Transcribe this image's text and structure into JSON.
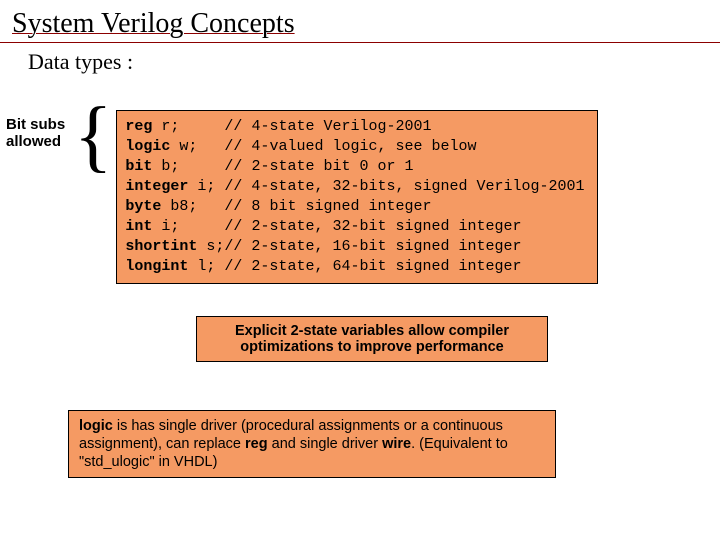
{
  "title": "System Verilog Concepts",
  "subtitle": "Data types :",
  "sideLabel": "Bit subs allowed",
  "code": {
    "lines": [
      {
        "kw": "reg",
        "decl": " r;     ",
        "cmt": "// 4-state Verilog-2001"
      },
      {
        "kw": "logic",
        "decl": " w;   ",
        "cmt": "// 4-valued logic, see below"
      },
      {
        "kw": "bit",
        "decl": " b;     ",
        "cmt": "// 2-state bit 0 or 1"
      },
      {
        "kw": "integer",
        "decl": " i; ",
        "cmt": "// 4-state, 32-bits, signed Verilog-2001"
      },
      {
        "kw": "byte",
        "decl": " b8;   ",
        "cmt": "// 8 bit signed integer"
      },
      {
        "kw": "int",
        "decl": " i;     ",
        "cmt": "// 2-state, 32-bit signed integer"
      },
      {
        "kw": "shortint",
        "decl": " s;",
        "cmt": "// 2-state, 16-bit signed integer"
      },
      {
        "kw": "longint",
        "decl": " l; ",
        "cmt": "// 2-state, 64-bit signed integer"
      }
    ]
  },
  "callout1": "Explicit 2-state variables allow compiler optimizations to improve performance",
  "callout2": {
    "b1": "logic",
    "t1": " is has single driver (procedural assignments or a continuous assignment), can replace ",
    "b2": "reg",
    "t2": " and single driver ",
    "b3": "wire",
    "t3": ". (Equivalent to \"std_ulogic\" in VHDL)"
  }
}
